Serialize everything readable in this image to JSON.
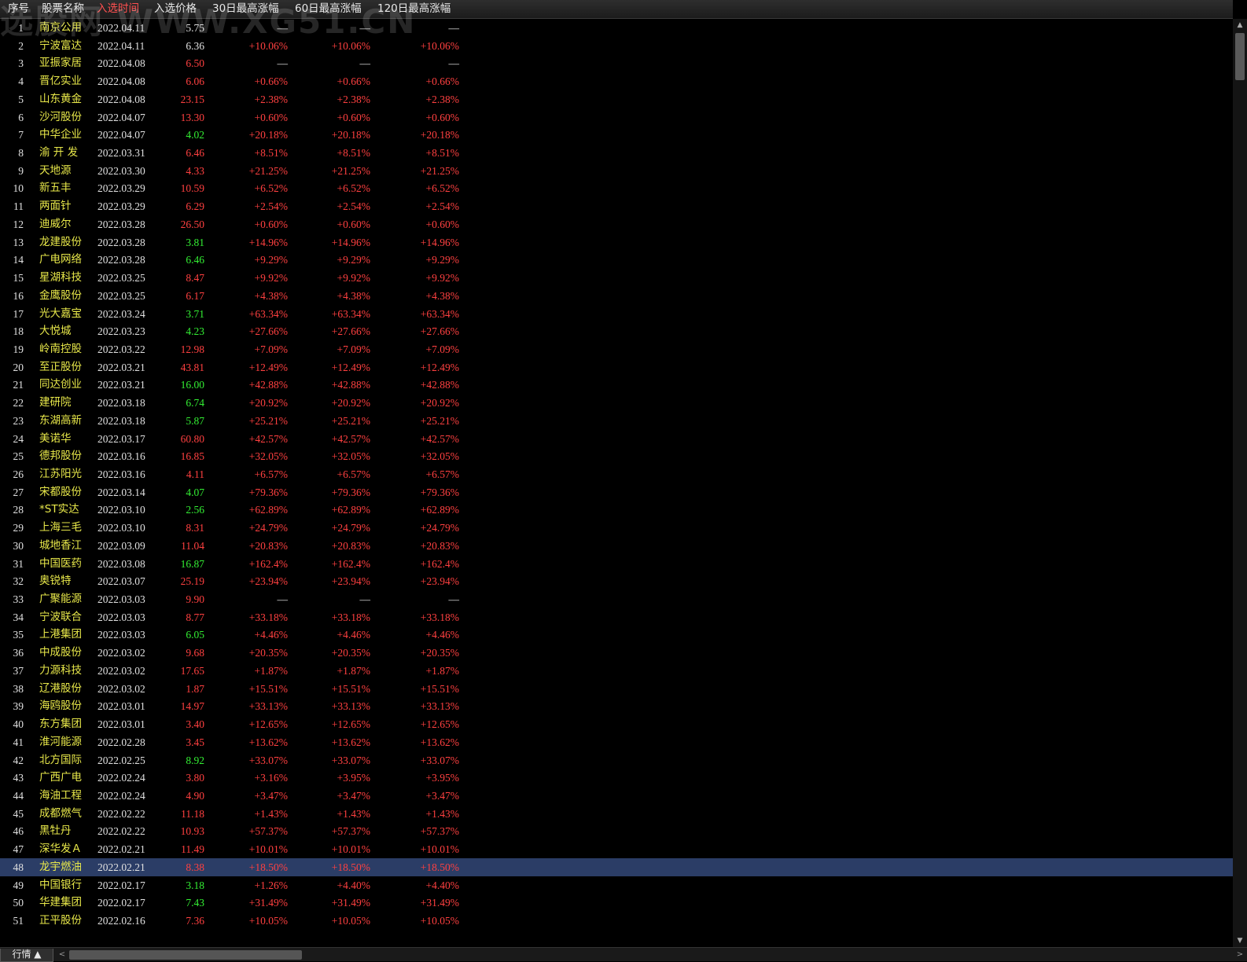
{
  "header": {
    "columns": [
      "序号",
      "股票名称",
      "入选时间",
      "入选价格",
      "30日最高涨幅",
      "60日最高涨幅",
      "120日最高涨幅"
    ],
    "active_index": 2
  },
  "watermark": "选股网 WWW.XG51.CN",
  "colors": {
    "up": "#ff4040",
    "down": "#33ee33",
    "name": "#e8e84a",
    "selected_row": "#2b3d66"
  },
  "rows": [
    {
      "idx": "1",
      "name": "南京公用",
      "date": "2022.04.11",
      "price": "5.75",
      "dir": "flat",
      "g30": "—",
      "g60": "—",
      "g120": "—"
    },
    {
      "idx": "2",
      "name": "宁波富达",
      "date": "2022.04.11",
      "price": "6.36",
      "dir": "flat",
      "g30": "+10.06%",
      "g60": "+10.06%",
      "g120": "+10.06%"
    },
    {
      "idx": "3",
      "name": "亚振家居",
      "date": "2022.04.08",
      "price": "6.50",
      "dir": "up",
      "g30": "—",
      "g60": "—",
      "g120": "—"
    },
    {
      "idx": "4",
      "name": "晋亿实业",
      "date": "2022.04.08",
      "price": "6.06",
      "dir": "up",
      "g30": "+0.66%",
      "g60": "+0.66%",
      "g120": "+0.66%"
    },
    {
      "idx": "5",
      "name": "山东黄金",
      "date": "2022.04.08",
      "price": "23.15",
      "dir": "up",
      "g30": "+2.38%",
      "g60": "+2.38%",
      "g120": "+2.38%"
    },
    {
      "idx": "6",
      "name": "沙河股份",
      "date": "2022.04.07",
      "price": "13.30",
      "dir": "up",
      "g30": "+0.60%",
      "g60": "+0.60%",
      "g120": "+0.60%"
    },
    {
      "idx": "7",
      "name": "中华企业",
      "date": "2022.04.07",
      "price": "4.02",
      "dir": "down",
      "g30": "+20.18%",
      "g60": "+20.18%",
      "g120": "+20.18%"
    },
    {
      "idx": "8",
      "name": "渝 开 发",
      "date": "2022.03.31",
      "price": "6.46",
      "dir": "up",
      "g30": "+8.51%",
      "g60": "+8.51%",
      "g120": "+8.51%"
    },
    {
      "idx": "9",
      "name": "天地源",
      "date": "2022.03.30",
      "price": "4.33",
      "dir": "up",
      "g30": "+21.25%",
      "g60": "+21.25%",
      "g120": "+21.25%"
    },
    {
      "idx": "10",
      "name": "新五丰",
      "date": "2022.03.29",
      "price": "10.59",
      "dir": "up",
      "g30": "+6.52%",
      "g60": "+6.52%",
      "g120": "+6.52%"
    },
    {
      "idx": "11",
      "name": "两面针",
      "date": "2022.03.29",
      "price": "6.29",
      "dir": "up",
      "g30": "+2.54%",
      "g60": "+2.54%",
      "g120": "+2.54%"
    },
    {
      "idx": "12",
      "name": "迪威尔",
      "date": "2022.03.28",
      "price": "26.50",
      "dir": "up",
      "g30": "+0.60%",
      "g60": "+0.60%",
      "g120": "+0.60%"
    },
    {
      "idx": "13",
      "name": "龙建股份",
      "date": "2022.03.28",
      "price": "3.81",
      "dir": "down",
      "g30": "+14.96%",
      "g60": "+14.96%",
      "g120": "+14.96%"
    },
    {
      "idx": "14",
      "name": "广电网络",
      "date": "2022.03.28",
      "price": "6.46",
      "dir": "down",
      "g30": "+9.29%",
      "g60": "+9.29%",
      "g120": "+9.29%"
    },
    {
      "idx": "15",
      "name": "星湖科技",
      "date": "2022.03.25",
      "price": "8.47",
      "dir": "up",
      "g30": "+9.92%",
      "g60": "+9.92%",
      "g120": "+9.92%"
    },
    {
      "idx": "16",
      "name": "金鹰股份",
      "date": "2022.03.25",
      "price": "6.17",
      "dir": "up",
      "g30": "+4.38%",
      "g60": "+4.38%",
      "g120": "+4.38%"
    },
    {
      "idx": "17",
      "name": "光大嘉宝",
      "date": "2022.03.24",
      "price": "3.71",
      "dir": "down",
      "g30": "+63.34%",
      "g60": "+63.34%",
      "g120": "+63.34%"
    },
    {
      "idx": "18",
      "name": "大悦城",
      "date": "2022.03.23",
      "price": "4.23",
      "dir": "down",
      "g30": "+27.66%",
      "g60": "+27.66%",
      "g120": "+27.66%"
    },
    {
      "idx": "19",
      "name": "岭南控股",
      "date": "2022.03.22",
      "price": "12.98",
      "dir": "up",
      "g30": "+7.09%",
      "g60": "+7.09%",
      "g120": "+7.09%"
    },
    {
      "idx": "20",
      "name": "至正股份",
      "date": "2022.03.21",
      "price": "43.81",
      "dir": "up",
      "g30": "+12.49%",
      "g60": "+12.49%",
      "g120": "+12.49%"
    },
    {
      "idx": "21",
      "name": "同达创业",
      "date": "2022.03.21",
      "price": "16.00",
      "dir": "down",
      "g30": "+42.88%",
      "g60": "+42.88%",
      "g120": "+42.88%"
    },
    {
      "idx": "22",
      "name": "建研院",
      "date": "2022.03.18",
      "price": "6.74",
      "dir": "down",
      "g30": "+20.92%",
      "g60": "+20.92%",
      "g120": "+20.92%"
    },
    {
      "idx": "23",
      "name": "东湖高新",
      "date": "2022.03.18",
      "price": "5.87",
      "dir": "down",
      "g30": "+25.21%",
      "g60": "+25.21%",
      "g120": "+25.21%"
    },
    {
      "idx": "24",
      "name": "美诺华",
      "date": "2022.03.17",
      "price": "60.80",
      "dir": "up",
      "g30": "+42.57%",
      "g60": "+42.57%",
      "g120": "+42.57%"
    },
    {
      "idx": "25",
      "name": "德邦股份",
      "date": "2022.03.16",
      "price": "16.85",
      "dir": "up",
      "g30": "+32.05%",
      "g60": "+32.05%",
      "g120": "+32.05%"
    },
    {
      "idx": "26",
      "name": "江苏阳光",
      "date": "2022.03.16",
      "price": "4.11",
      "dir": "up",
      "g30": "+6.57%",
      "g60": "+6.57%",
      "g120": "+6.57%"
    },
    {
      "idx": "27",
      "name": "宋都股份",
      "date": "2022.03.14",
      "price": "4.07",
      "dir": "down",
      "g30": "+79.36%",
      "g60": "+79.36%",
      "g120": "+79.36%"
    },
    {
      "idx": "28",
      "name": "*ST实达",
      "date": "2022.03.10",
      "price": "2.56",
      "dir": "down",
      "g30": "+62.89%",
      "g60": "+62.89%",
      "g120": "+62.89%"
    },
    {
      "idx": "29",
      "name": "上海三毛",
      "date": "2022.03.10",
      "price": "8.31",
      "dir": "up",
      "g30": "+24.79%",
      "g60": "+24.79%",
      "g120": "+24.79%"
    },
    {
      "idx": "30",
      "name": "城地香江",
      "date": "2022.03.09",
      "price": "11.04",
      "dir": "up",
      "g30": "+20.83%",
      "g60": "+20.83%",
      "g120": "+20.83%"
    },
    {
      "idx": "31",
      "name": "中国医药",
      "date": "2022.03.08",
      "price": "16.87",
      "dir": "down",
      "g30": "+162.4%",
      "g60": "+162.4%",
      "g120": "+162.4%"
    },
    {
      "idx": "32",
      "name": "奥锐特",
      "date": "2022.03.07",
      "price": "25.19",
      "dir": "up",
      "g30": "+23.94%",
      "g60": "+23.94%",
      "g120": "+23.94%"
    },
    {
      "idx": "33",
      "name": "广聚能源",
      "date": "2022.03.03",
      "price": "9.90",
      "dir": "up",
      "g30": "—",
      "g60": "—",
      "g120": "—"
    },
    {
      "idx": "34",
      "name": "宁波联合",
      "date": "2022.03.03",
      "price": "8.77",
      "dir": "up",
      "g30": "+33.18%",
      "g60": "+33.18%",
      "g120": "+33.18%"
    },
    {
      "idx": "35",
      "name": "上港集团",
      "date": "2022.03.03",
      "price": "6.05",
      "dir": "down",
      "g30": "+4.46%",
      "g60": "+4.46%",
      "g120": "+4.46%"
    },
    {
      "idx": "36",
      "name": "中成股份",
      "date": "2022.03.02",
      "price": "9.68",
      "dir": "up",
      "g30": "+20.35%",
      "g60": "+20.35%",
      "g120": "+20.35%"
    },
    {
      "idx": "37",
      "name": "力源科技",
      "date": "2022.03.02",
      "price": "17.65",
      "dir": "up",
      "g30": "+1.87%",
      "g60": "+1.87%",
      "g120": "+1.87%"
    },
    {
      "idx": "38",
      "name": "辽港股份",
      "date": "2022.03.02",
      "price": "1.87",
      "dir": "up",
      "g30": "+15.51%",
      "g60": "+15.51%",
      "g120": "+15.51%"
    },
    {
      "idx": "39",
      "name": "海鸥股份",
      "date": "2022.03.01",
      "price": "14.97",
      "dir": "up",
      "g30": "+33.13%",
      "g60": "+33.13%",
      "g120": "+33.13%"
    },
    {
      "idx": "40",
      "name": "东方集团",
      "date": "2022.03.01",
      "price": "3.40",
      "dir": "up",
      "g30": "+12.65%",
      "g60": "+12.65%",
      "g120": "+12.65%"
    },
    {
      "idx": "41",
      "name": "淮河能源",
      "date": "2022.02.28",
      "price": "3.45",
      "dir": "up",
      "g30": "+13.62%",
      "g60": "+13.62%",
      "g120": "+13.62%"
    },
    {
      "idx": "42",
      "name": "北方国际",
      "date": "2022.02.25",
      "price": "8.92",
      "dir": "down",
      "g30": "+33.07%",
      "g60": "+33.07%",
      "g120": "+33.07%"
    },
    {
      "idx": "43",
      "name": "广西广电",
      "date": "2022.02.24",
      "price": "3.80",
      "dir": "up",
      "g30": "+3.16%",
      "g60": "+3.95%",
      "g120": "+3.95%"
    },
    {
      "idx": "44",
      "name": "海油工程",
      "date": "2022.02.24",
      "price": "4.90",
      "dir": "up",
      "g30": "+3.47%",
      "g60": "+3.47%",
      "g120": "+3.47%"
    },
    {
      "idx": "45",
      "name": "成都燃气",
      "date": "2022.02.22",
      "price": "11.18",
      "dir": "up",
      "g30": "+1.43%",
      "g60": "+1.43%",
      "g120": "+1.43%"
    },
    {
      "idx": "46",
      "name": "黑牡丹",
      "date": "2022.02.22",
      "price": "10.93",
      "dir": "up",
      "g30": "+57.37%",
      "g60": "+57.37%",
      "g120": "+57.37%"
    },
    {
      "idx": "47",
      "name": "深华发Ａ",
      "date": "2022.02.21",
      "price": "11.49",
      "dir": "up",
      "g30": "+10.01%",
      "g60": "+10.01%",
      "g120": "+10.01%"
    },
    {
      "idx": "48",
      "name": "龙宇燃油",
      "date": "2022.02.21",
      "price": "8.38",
      "dir": "up",
      "g30": "+18.50%",
      "g60": "+18.50%",
      "g120": "+18.50%",
      "selected": true
    },
    {
      "idx": "49",
      "name": "中国银行",
      "date": "2022.02.17",
      "price": "3.18",
      "dir": "down",
      "g30": "+1.26%",
      "g60": "+4.40%",
      "g120": "+4.40%"
    },
    {
      "idx": "50",
      "name": "华建集团",
      "date": "2022.02.17",
      "price": "7.43",
      "dir": "down",
      "g30": "+31.49%",
      "g60": "+31.49%",
      "g120": "+31.49%"
    },
    {
      "idx": "51",
      "name": "正平股份",
      "date": "2022.02.16",
      "price": "7.36",
      "dir": "up",
      "g30": "+10.05%",
      "g60": "+10.05%",
      "g120": "+10.05%"
    }
  ],
  "bottom": {
    "tab_label": "行情 ▲"
  }
}
